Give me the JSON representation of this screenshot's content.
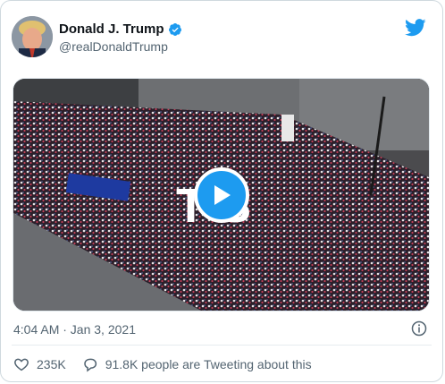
{
  "tweet": {
    "author_name": "Donald J. Trump",
    "author_handle": "@realDonaldTrump",
    "timestamp": "4:04 AM · Jan 3, 2021",
    "likes": "235K",
    "replies_text": "91.8K people are Tweeting about this"
  },
  "media": {
    "type": "video",
    "overlay_text": "T  S"
  },
  "icons": {
    "verified": "verified-badge-icon",
    "brand": "twitter-bird-icon",
    "play": "play-icon",
    "info": "info-icon",
    "like": "heart-icon",
    "reply": "comment-icon"
  },
  "colors": {
    "accent": "#1d9bf0",
    "secondary_text": "#536471",
    "border": "#cfd9de"
  }
}
